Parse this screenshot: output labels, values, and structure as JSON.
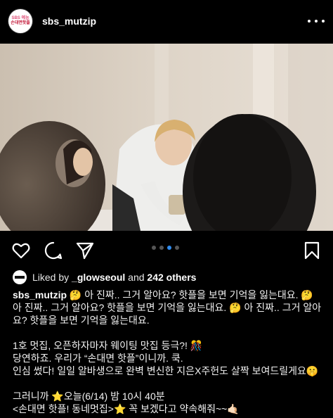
{
  "post": {
    "account_name": "sbs_mutzip",
    "avatar_text_top": "SBS 예능",
    "avatar_text_bottom": "손대면핫플",
    "more_icon": "more-horizontal-icon"
  },
  "carousel": {
    "page_count": 4,
    "active_index": 2
  },
  "actions": {
    "like_icon": "heart-icon",
    "comment_icon": "comment-icon",
    "share_icon": "send-icon",
    "save_icon": "bookmark-icon"
  },
  "likes": {
    "prefix": "Liked by ",
    "liker": "_glowseoul",
    "middle": " and ",
    "others": "242 others"
  },
  "caption": {
    "username": "sbs_mutzip",
    "text": " 🤔 아 진짜.. 그거 알아요? 핫플을 보면 기억을 잃는대요. 🤔 아 진짜.. 그거 알아요? 핫플을 보면 기억을 잃는대요. 🤔 아 진짜.. 그거 알아요? 핫플을 보면 기억을 잃는대요.\n\n1호 멋집, 오픈하자마자 웨이팅 맛집 등극?! 🎊\n당연하죠. 우리가 “손대면 핫플”이니까. 쿡.\n인심 썼다! 일일 알바생으로 완벽 변신한 지은X주헌도 살짝 보여드릴게요🤫\n\n그러니까 ⭐오늘(6/14) 밤 10시 40분\n<손대면 핫플! 동네멋집>⭐ 꼭 보겠다고 약속해줘~~🤙🏻"
  },
  "colors": {
    "background": "#000000",
    "text": "#f5f5f5",
    "active_dot": "#2f8cf0",
    "inactive_dot": "#555555",
    "brand": "#c41a3a"
  }
}
